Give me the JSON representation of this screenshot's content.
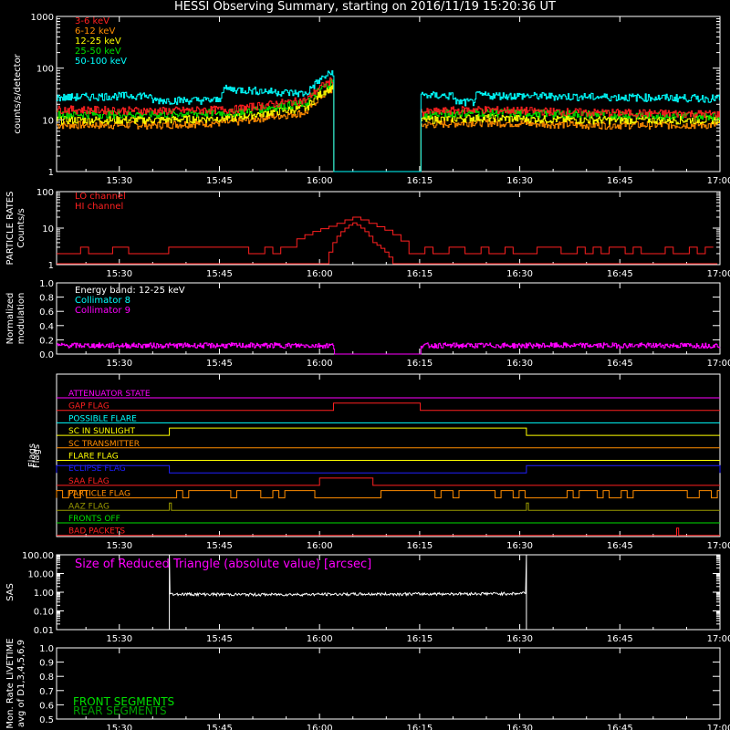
{
  "title": "HESSI Observing Summary, starting on 2016/11/19 15:20:36 UT",
  "colors": {
    "bg": "#000000",
    "axis": "#ffffff",
    "red": "#ff2020",
    "orange": "#ff8c00",
    "yellow": "#ffff00",
    "green": "#00e000",
    "cyan": "#00ffff",
    "magenta": "#ff00ff",
    "blue": "#2020ff",
    "olive": "#9a9a00",
    "dkgreen": "#00a000",
    "white": "#ffffff"
  },
  "time_axis": {
    "start_min": 920.6,
    "end_min": 1020,
    "ticks": [
      {
        "min": 930,
        "label": "15:30"
      },
      {
        "min": 945,
        "label": "15:45"
      },
      {
        "min": 960,
        "label": "16:00"
      },
      {
        "min": 975,
        "label": "16:15"
      },
      {
        "min": 990,
        "label": "16:30"
      },
      {
        "min": 1005,
        "label": "16:45"
      },
      {
        "min": 1020,
        "label": "17:00"
      }
    ]
  },
  "chart_data": [
    {
      "type": "line",
      "panel": "counts",
      "ylabel": "counts/s/detector",
      "yscale": "log",
      "ylim": [
        1,
        1000
      ],
      "yticks": [
        "1",
        "10",
        "100",
        "1000"
      ],
      "series": [
        {
          "name": "3-6 keV",
          "color": "#ff2020",
          "points": [
            [
              920.6,
              16
            ],
            [
              936,
              15
            ],
            [
              947,
              16
            ],
            [
              958,
              24
            ],
            [
              962,
              60
            ],
            [
              962.1,
              0
            ],
            [
              975.1,
              0
            ],
            [
              975.2,
              14
            ],
            [
              983,
              16
            ],
            [
              1000,
              14
            ],
            [
              1020,
              13
            ]
          ]
        },
        {
          "name": "6-12 keV",
          "color": "#ff8c00",
          "points": [
            [
              920.6,
              8
            ],
            [
              936,
              8
            ],
            [
              947,
              9
            ],
            [
              958,
              14
            ],
            [
              962,
              40
            ],
            [
              962.1,
              0
            ],
            [
              975.1,
              0
            ],
            [
              975.2,
              8
            ],
            [
              983,
              9
            ],
            [
              1000,
              8
            ],
            [
              1020,
              8
            ]
          ]
        },
        {
          "name": "12-25 keV",
          "color": "#ffff00",
          "points": [
            [
              920.6,
              10
            ],
            [
              936,
              10
            ],
            [
              947,
              11
            ],
            [
              958,
              17
            ],
            [
              962,
              45
            ],
            [
              962.1,
              0
            ],
            [
              975.1,
              0
            ],
            [
              975.2,
              10
            ],
            [
              983,
              11
            ],
            [
              1000,
              10
            ],
            [
              1020,
              10
            ]
          ]
        },
        {
          "name": "25-50 keV",
          "color": "#00e000",
          "points": [
            [
              920.6,
              13
            ],
            [
              936,
              13
            ],
            [
              947,
              14
            ],
            [
              958,
              21
            ],
            [
              962,
              55
            ],
            [
              962.1,
              0
            ],
            [
              975.1,
              0
            ],
            [
              975.2,
              13
            ],
            [
              983,
              14
            ],
            [
              1000,
              13
            ],
            [
              1020,
              12
            ]
          ]
        },
        {
          "name": "50-100 keV",
          "color": "#00ffff",
          "points": [
            [
              920.6,
              27
            ],
            [
              934,
              30
            ],
            [
              935,
              24
            ],
            [
              945,
              24
            ],
            [
              945.5,
              40
            ],
            [
              958,
              32
            ],
            [
              962,
              85
            ],
            [
              962.1,
              0
            ],
            [
              975.1,
              0
            ],
            [
              975.2,
              30
            ],
            [
              980,
              29
            ],
            [
              980.5,
              22
            ],
            [
              983,
              22
            ],
            [
              983.5,
              30
            ],
            [
              1000,
              28
            ],
            [
              1020,
              26
            ]
          ]
        }
      ]
    },
    {
      "type": "line",
      "panel": "particle",
      "ylabel": "PARTICLE RATES Counts/s",
      "yscale": "log",
      "ylim": [
        1,
        100
      ],
      "yticks": [
        "1",
        "10",
        "100"
      ],
      "series": [
        {
          "name": "LO channel",
          "color": "#ff2020",
          "points": [
            [
              920.6,
              2
            ],
            [
              936,
              2
            ],
            [
              937,
              3
            ],
            [
              955,
              3
            ],
            [
              962,
              12
            ],
            [
              965,
              20
            ],
            [
              968,
              12
            ],
            [
              973,
              3
            ],
            [
              1020,
              3
            ]
          ]
        },
        {
          "name": "HI channel",
          "color": "#ff2020",
          "points": [
            [
              920.6,
              1
            ],
            [
              961,
              1
            ],
            [
              962,
              4
            ],
            [
              965,
              14
            ],
            [
              968,
              4
            ],
            [
              971,
              1
            ],
            [
              1020,
              1
            ]
          ]
        }
      ]
    },
    {
      "type": "line",
      "panel": "modulation",
      "ylabel": "Normalized modulation",
      "ylim": [
        0,
        1
      ],
      "yticks": [
        "0.0",
        "0.2",
        "0.4",
        "0.6",
        "0.8",
        "1.0"
      ],
      "annotation": "Energy band: 12-25 keV",
      "series": [
        {
          "name": "Collimator 8",
          "color": "#00ffff",
          "points": []
        },
        {
          "name": "Collimator 9",
          "color": "#ff00ff",
          "points": [
            [
              920.6,
              0.12
            ],
            [
              962.1,
              0.12
            ],
            [
              962.2,
              0
            ],
            [
              975.1,
              0
            ],
            [
              975.2,
              0.12
            ],
            [
              1020,
              0.12
            ]
          ]
        }
      ]
    },
    {
      "type": "line",
      "panel": "flags",
      "ylabel": "Flags",
      "series": [
        {
          "name": "ATTENUATOR STATE",
          "color": "#ff00ff",
          "segments": []
        },
        {
          "name": "GAP FLAG",
          "color": "#ff2020",
          "segments": [
            [
              962.1,
              975.1
            ]
          ]
        },
        {
          "name": "POSSIBLE FLARE",
          "color": "#00ffff",
          "segments": []
        },
        {
          "name": "SC IN SUNLIGHT",
          "color": "#ffff00",
          "segments": [
            [
              937.5,
              991
            ]
          ]
        },
        {
          "name": "SC TRANSMITTER",
          "color": "#ff8c00",
          "segments": []
        },
        {
          "name": "FLARE FLAG",
          "color": "#ffff00",
          "segments": []
        },
        {
          "name": "ECLIPSE FLAG",
          "color": "#2020ff",
          "segments": [
            [
              920.6,
              937.5
            ],
            [
              991,
              1020
            ]
          ]
        },
        {
          "name": "SAA FLAG",
          "color": "#ff2020",
          "segments": [
            [
              960,
              968
            ]
          ]
        },
        {
          "name": "PARTICLE FLAG",
          "color": "#ff8c00",
          "segments": [
            [
              920.6,
              925
            ],
            [
              937.5,
              960
            ],
            [
              969,
              991
            ],
            [
              996,
              1020
            ]
          ]
        },
        {
          "name": "AAZ FLAG",
          "color": "#9a9a00",
          "segments": [
            [
              937.5,
              937.8
            ],
            [
              991,
              991.3
            ]
          ]
        },
        {
          "name": "FRONTS OFF",
          "color": "#00e000",
          "segments": []
        },
        {
          "name": "BAD PACKETS",
          "color": "#ff2020",
          "segments": [
            [
              1013.5,
              1013.8
            ]
          ]
        }
      ]
    },
    {
      "type": "line",
      "panel": "sas",
      "ylabel": "SAS",
      "yscale": "log",
      "ylim": [
        0.01,
        100
      ],
      "yticks": [
        "0.01",
        "0.10",
        "1.00",
        "10.00",
        "100.00"
      ],
      "annotation": "Size of Reduced Triangle (absolute value) [arcsec]",
      "series": [
        {
          "name": "Size of Reduced Triangle",
          "color": "#ffffff",
          "points": [
            [
              937.5,
              100
            ],
            [
              937.6,
              0.8
            ],
            [
              950,
              0.75
            ],
            [
              970,
              0.8
            ],
            [
              990,
              0.85
            ],
            [
              990.9,
              1
            ],
            [
              991,
              100
            ]
          ]
        }
      ]
    },
    {
      "type": "line",
      "panel": "livetime",
      "ylabel": "Mon. Rate LIVETIME avg of D1,3,4,5,6,9",
      "ylim": [
        0.5,
        1.0
      ],
      "yticks": [
        "0.5",
        "0.6",
        "0.7",
        "0.8",
        "0.9",
        "1.0"
      ],
      "series": [
        {
          "name": "FRONT SEGMENTS",
          "color": "#00e000",
          "points": []
        },
        {
          "name": "REAR SEGMENTS",
          "color": "#00a000",
          "points": []
        }
      ]
    }
  ]
}
